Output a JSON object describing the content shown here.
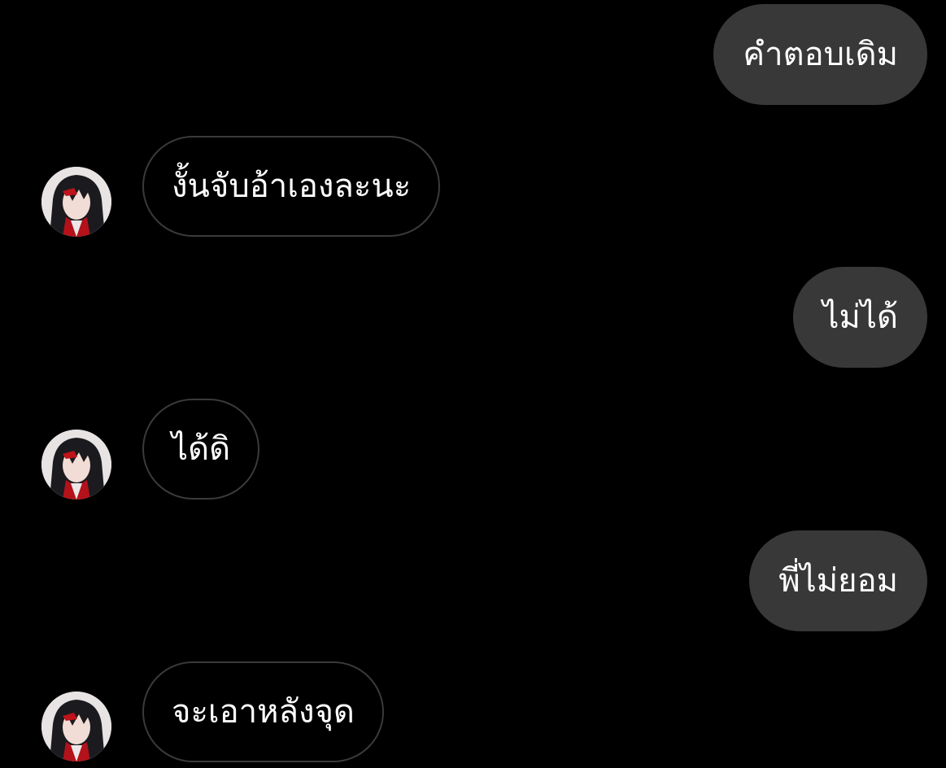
{
  "colors": {
    "background": "#000000",
    "outgoing_bubble": "#383838",
    "incoming_border": "#3a3a3a",
    "text": "#ffffff"
  },
  "messages": [
    {
      "direction": "outgoing",
      "text": "คำตอบเดิม"
    },
    {
      "direction": "incoming",
      "text": "งั้นจับอ้าเองละนะ",
      "avatar": "user-avatar"
    },
    {
      "direction": "outgoing",
      "text": "ไม่ได้"
    },
    {
      "direction": "incoming",
      "text": "ได้ดิ",
      "avatar": "user-avatar"
    },
    {
      "direction": "outgoing",
      "text": "พี่ไม่ยอม"
    },
    {
      "direction": "incoming",
      "text": "จะเอาหลังจุด",
      "avatar": "user-avatar"
    }
  ]
}
